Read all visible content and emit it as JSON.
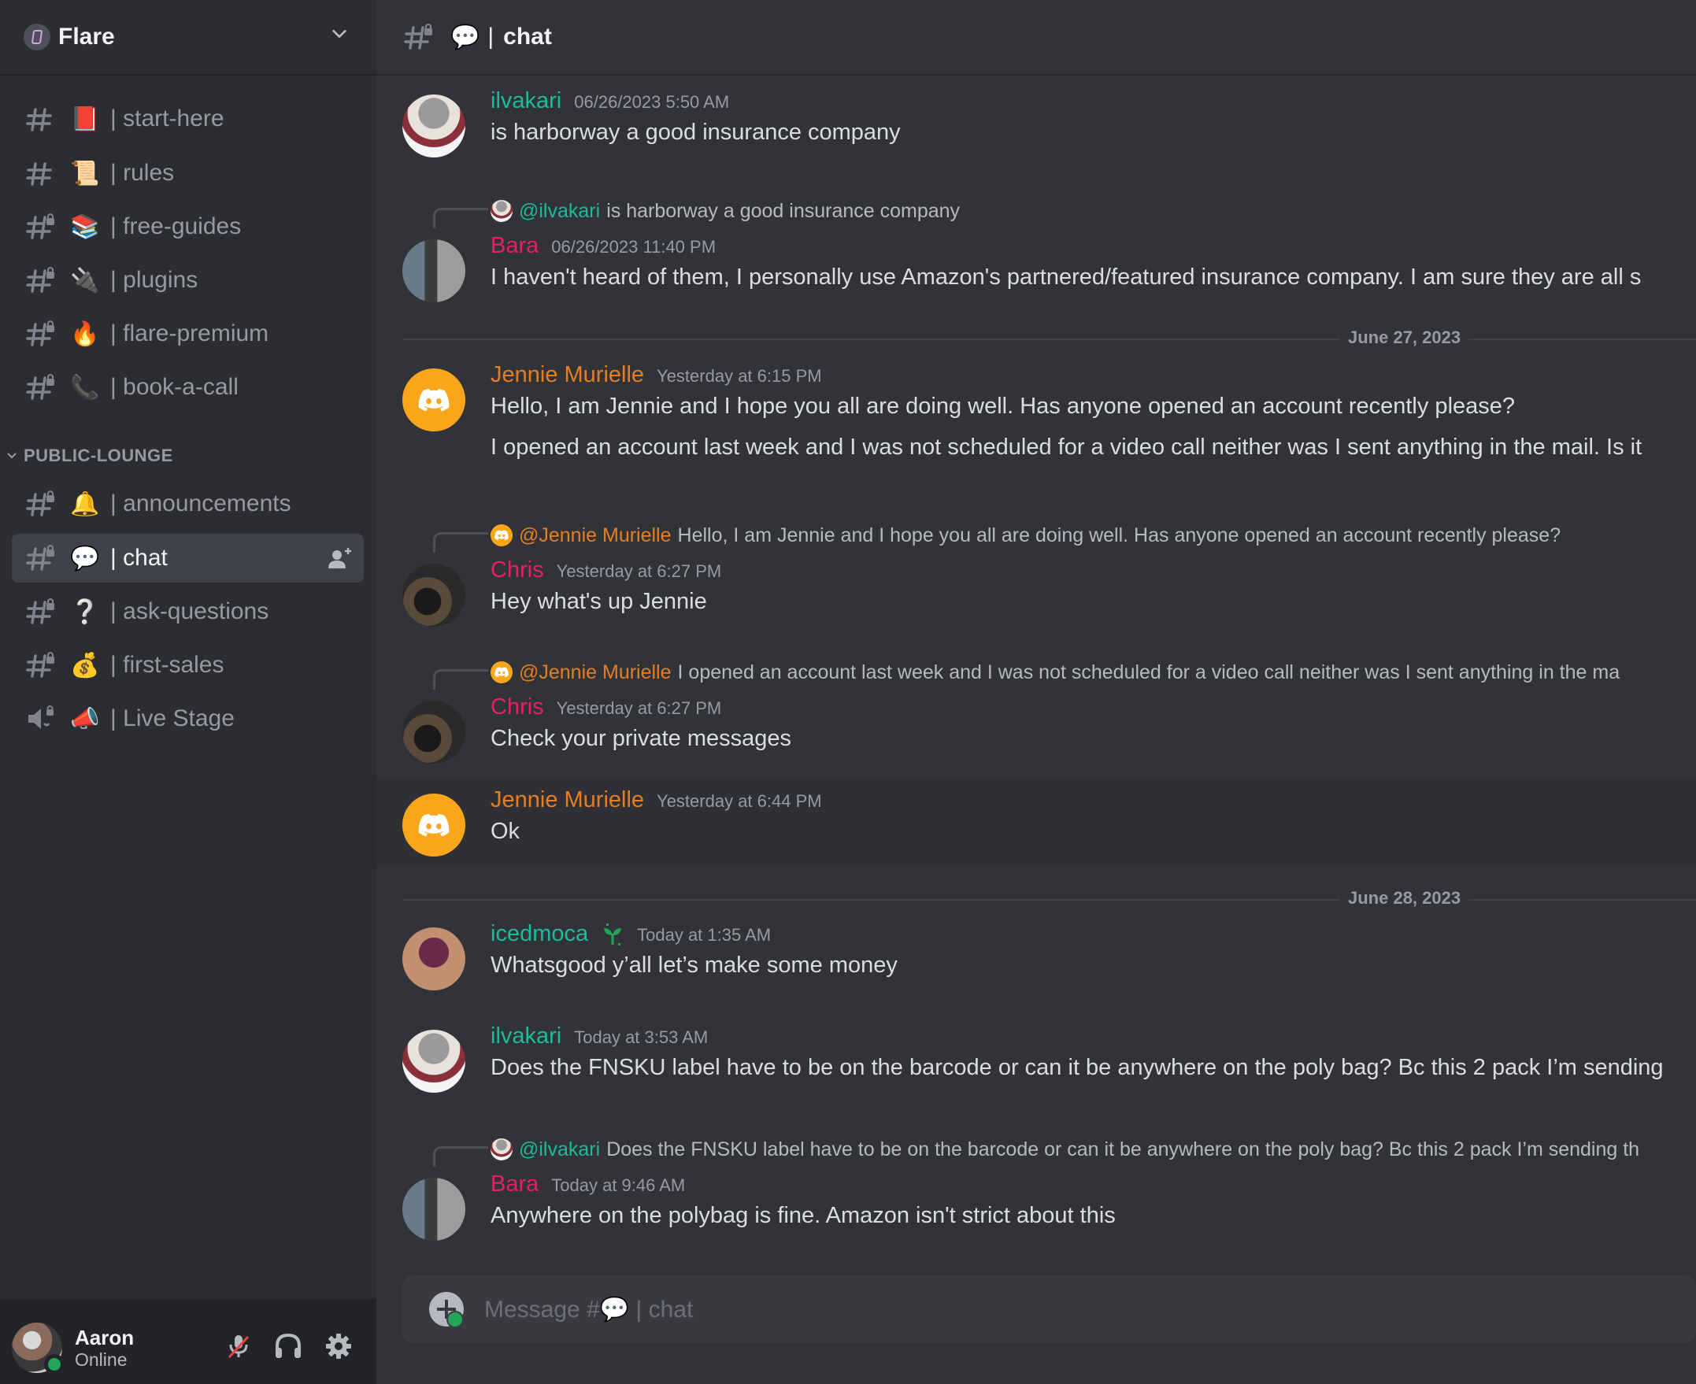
{
  "server": {
    "name": "Flare",
    "icon": "server-badge-icon",
    "dropdown_icon": "chevron-down-icon"
  },
  "channels": [
    {
      "emoji": "📕",
      "name": "| start-here",
      "type": "text",
      "locked": false
    },
    {
      "emoji": "📜",
      "name": "| rules",
      "type": "text",
      "locked": false
    },
    {
      "emoji": "📚",
      "name": "| free-guides",
      "type": "text",
      "locked": true
    },
    {
      "emoji": "🔌",
      "name": "| plugins",
      "type": "text",
      "locked": true
    },
    {
      "emoji": "🔥",
      "name": "| flare-premium",
      "type": "text",
      "locked": true
    },
    {
      "emoji": "📞",
      "name": "| book-a-call",
      "type": "text",
      "locked": true
    }
  ],
  "category": {
    "name": "PUBLIC-LOUNGE",
    "channels": [
      {
        "emoji": "🔔",
        "name": "| announcements",
        "type": "text",
        "locked": true,
        "selected": false
      },
      {
        "emoji": "💬",
        "name": "| chat",
        "type": "text",
        "locked": true,
        "selected": true
      },
      {
        "emoji": "❔",
        "name": "| ask-questions",
        "type": "text",
        "locked": true,
        "selected": false
      },
      {
        "emoji": "💰",
        "name": "| first-sales",
        "type": "text",
        "locked": true,
        "selected": false
      },
      {
        "emoji": "📣",
        "name": "| Live Stage",
        "type": "stage",
        "locked": true,
        "selected": false
      }
    ]
  },
  "user_panel": {
    "name": "Aaron",
    "status": "Online",
    "status_color": "#23a55a",
    "mute_icon": "microphone-muted-icon",
    "deafen_icon": "headphones-icon",
    "settings_icon": "gear-icon"
  },
  "header": {
    "emoji": "💬",
    "separator": "|",
    "title": "chat"
  },
  "colors": {
    "ilvakari": "#1abc9c",
    "bara": "#e91e63",
    "jennie": "#e67e22",
    "chris": "#e91e63",
    "icedmoca": "#1abc9c"
  },
  "messages": [
    {
      "author": "ilvakari",
      "timestamp": "06/26/2023 5:50 AM",
      "lines": [
        "is harborway a good insurance company"
      ]
    },
    {
      "author": "Bara",
      "timestamp": "06/26/2023 11:40 PM",
      "reply_to": {
        "mention": "@ilvakari",
        "text": "is harborway a good insurance company"
      },
      "lines": [
        "I haven't heard of them, I personally use Amazon's partnered/featured insurance company. I am sure they are all s"
      ]
    },
    {
      "divider": "June 27, 2023"
    },
    {
      "author": "Jennie Murielle",
      "timestamp": "Yesterday at 6:15 PM",
      "lines": [
        "Hello, I am Jennie and I hope you all are doing well. Has anyone opened an account recently please?",
        "I opened an account last week and I was not scheduled for a video call neither was I sent anything in the mail. Is it"
      ]
    },
    {
      "author": "Chris",
      "timestamp": "Yesterday at 6:27 PM",
      "reply_to": {
        "mention": "@Jennie Murielle",
        "text": "Hello, I am Jennie and I hope you all are doing well. Has anyone opened an account recently please?"
      },
      "lines": [
        "Hey what's up Jennie"
      ]
    },
    {
      "author": "Chris",
      "timestamp": "Yesterday at 6:27 PM",
      "reply_to": {
        "mention": "@Jennie Murielle",
        "text": "I opened an account last week and I was not scheduled for a video call neither was I sent anything in the ma"
      },
      "lines": [
        "Check your private messages"
      ]
    },
    {
      "author": "Jennie Murielle",
      "timestamp": "Yesterday at 6:44 PM",
      "lines": [
        "Ok"
      ]
    },
    {
      "divider": "June 28, 2023"
    },
    {
      "author": "icedmoca",
      "badge": "seedling-badge-icon",
      "timestamp": "Today at 1:35 AM",
      "lines": [
        "Whatsgood y’all let’s make some money"
      ]
    },
    {
      "author": "ilvakari",
      "timestamp": "Today at 3:53 AM",
      "lines": [
        "Does the FNSKU label have to be on the barcode or can it be anywhere on the poly bag? Bc this 2 pack I’m sending"
      ]
    },
    {
      "author": "Bara",
      "timestamp": "Today at 9:46 AM",
      "reply_to": {
        "mention": "@ilvakari",
        "text": "Does the FNSKU label have to be on the barcode or can it be anywhere on the poly bag? Bc this 2 pack I’m sending th"
      },
      "lines": [
        "Anywhere on the polybag is fine. Amazon isn't strict about this"
      ]
    }
  ],
  "composer": {
    "placeholder_prefix": "Message #",
    "placeholder_emoji": "💬",
    "placeholder_suffix": " | chat",
    "attach_icon": "add-attachment-icon"
  }
}
